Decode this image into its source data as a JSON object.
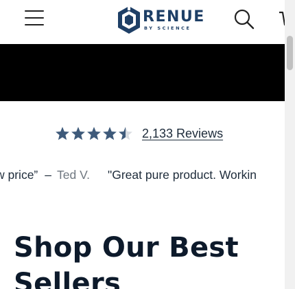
{
  "header": {
    "brand_name": "RENUE",
    "brand_tagline": "BY SCIENCE",
    "icons": [
      "menu-icon",
      "search-icon",
      "cart-icon"
    ],
    "brand_color": "#1e3f66"
  },
  "banner": {
    "color": "#000000"
  },
  "rating": {
    "stars_value": 4.5,
    "stars_max": 5,
    "star_color": "#3e5a7a",
    "reviews_label": "2,133 Reviews"
  },
  "testimonials": [
    {
      "text": "w price”",
      "author": "Ted V."
    },
    {
      "text": "\"Great pure product. Workin",
      "author": ""
    }
  ],
  "section": {
    "title": "Shop Our Best Sellers"
  }
}
